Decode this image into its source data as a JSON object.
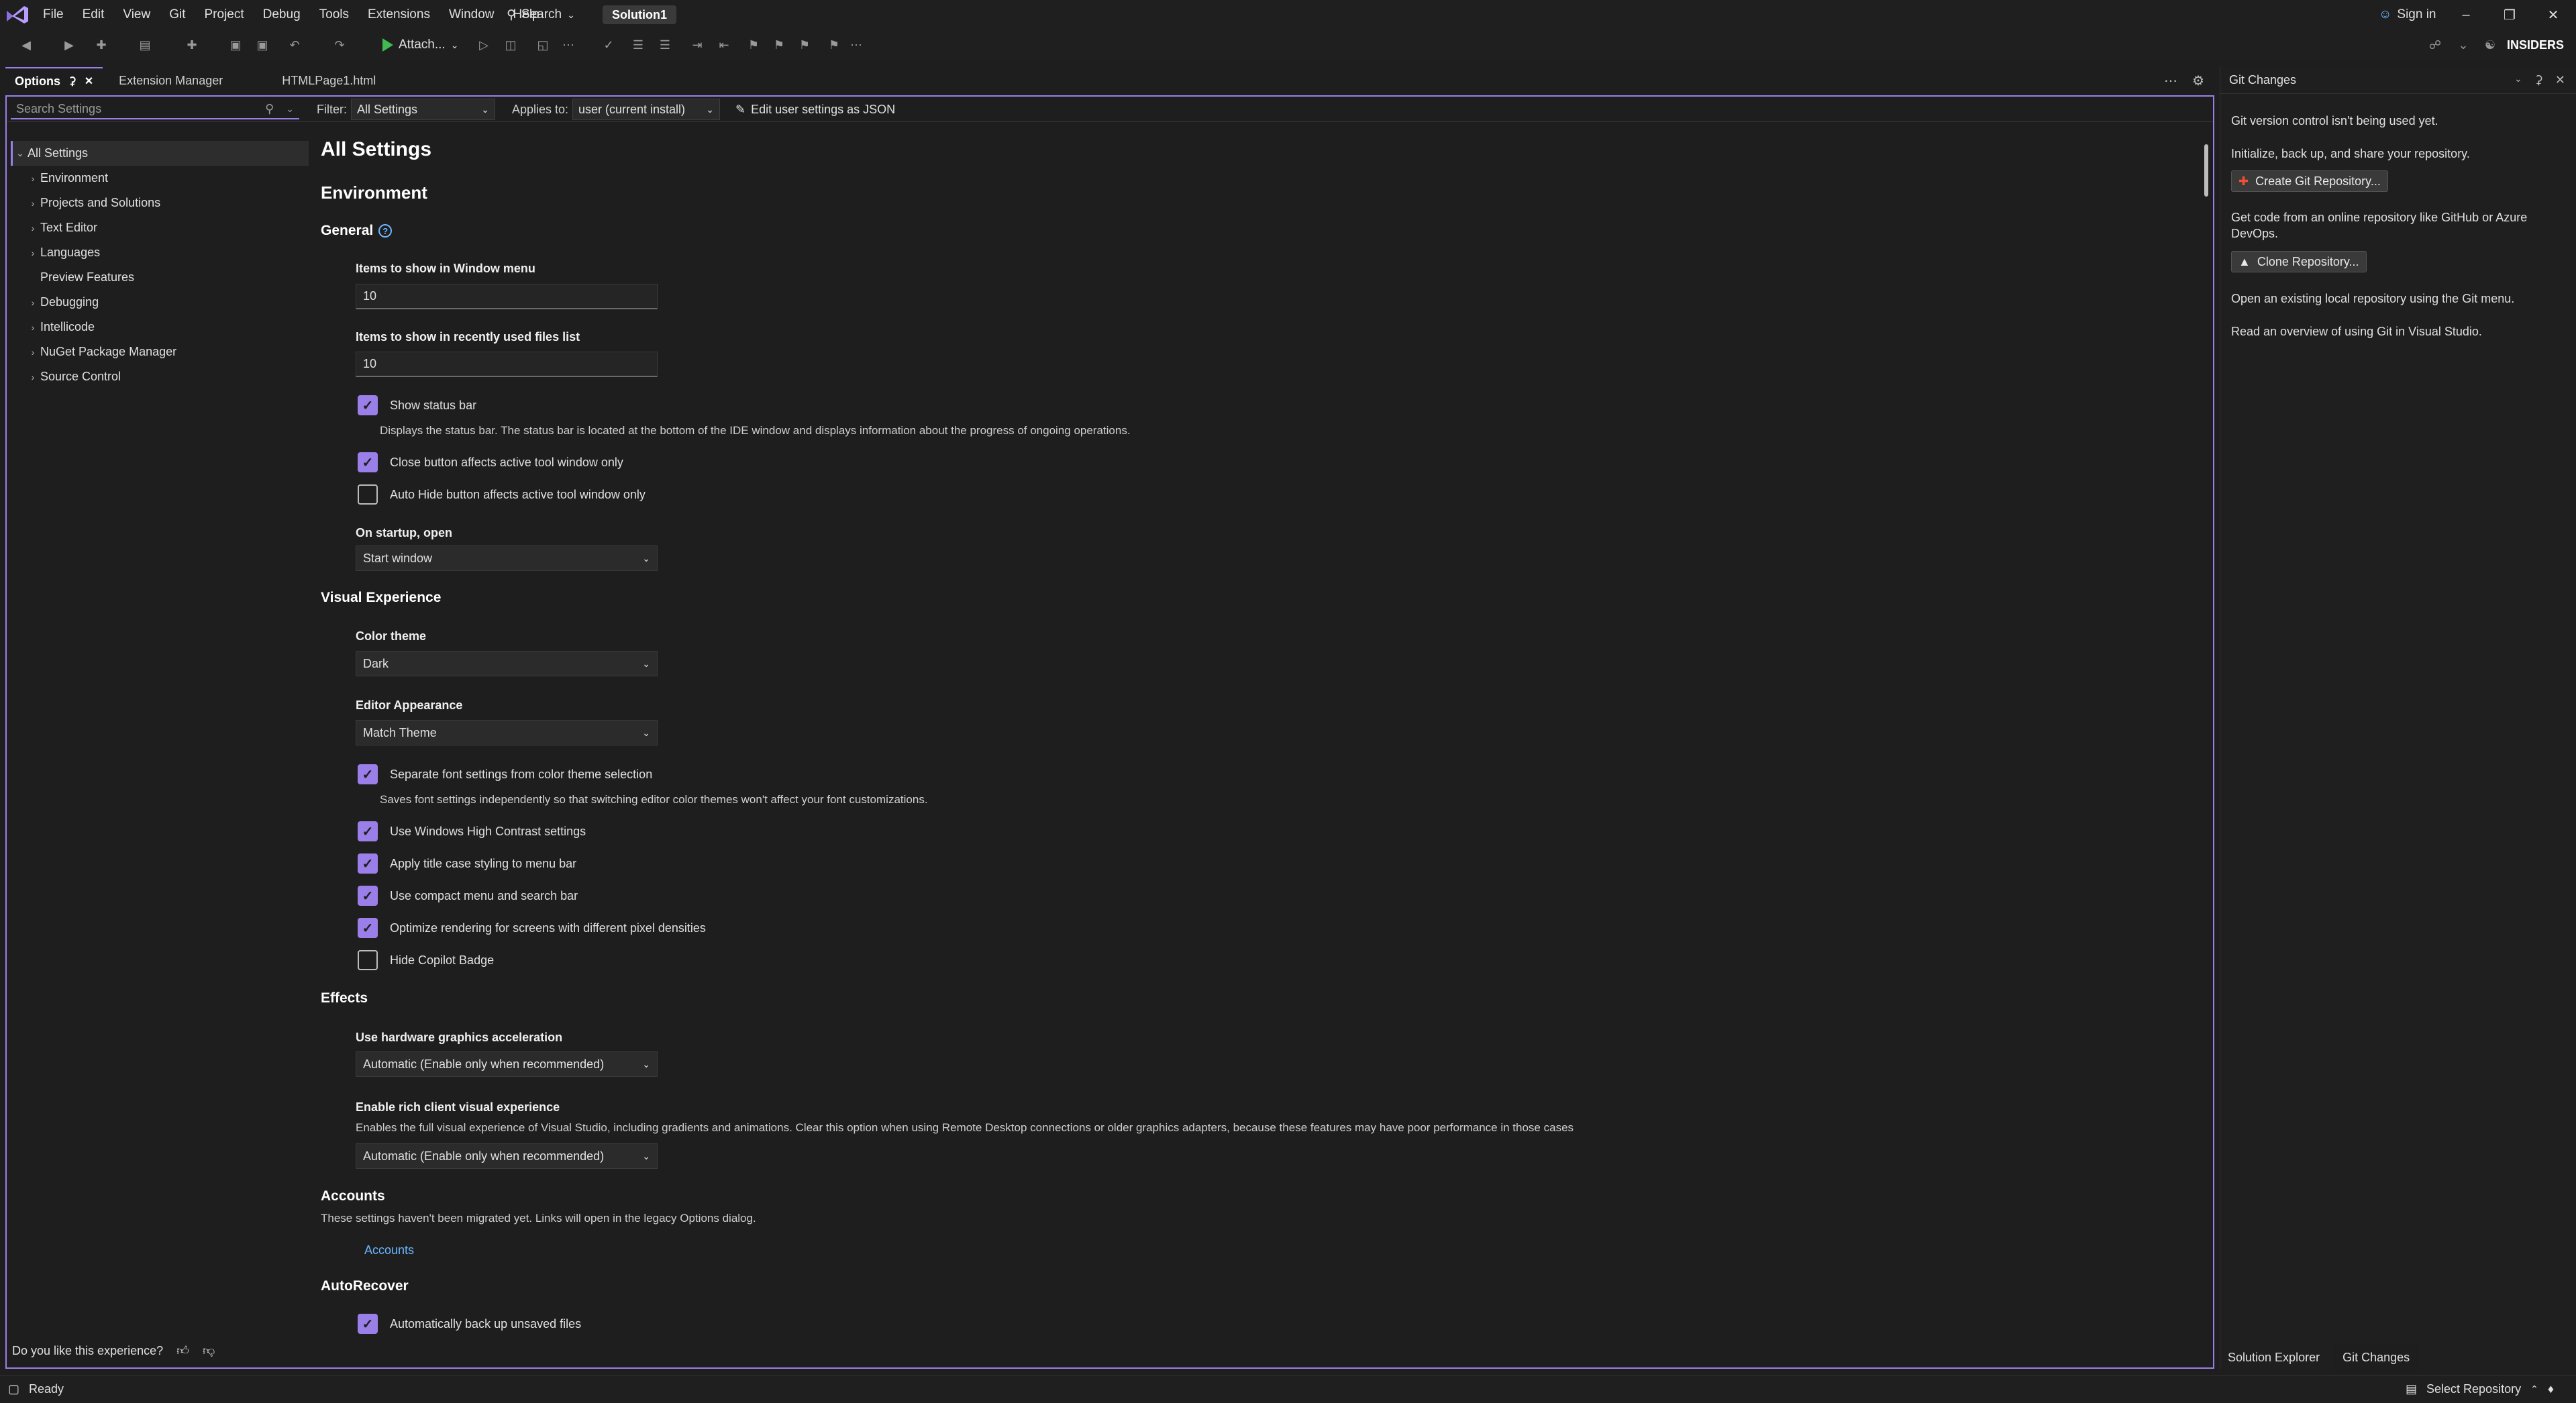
{
  "menu": {
    "items": [
      "File",
      "Edit",
      "View",
      "Git",
      "Project",
      "Debug",
      "Tools",
      "Extensions",
      "Window",
      "Help"
    ],
    "search_label": "Search",
    "solution": "Solution1",
    "sign_in": "Sign in"
  },
  "toolbar": {
    "attach_label": "Attach...",
    "insiders_label": "INSIDERS"
  },
  "tabs": [
    {
      "label": "Options",
      "active": true
    },
    {
      "label": "Extension Manager",
      "active": false
    },
    {
      "label": "HTMLPage1.html",
      "active": false
    }
  ],
  "filterbar": {
    "search_placeholder": "Search Settings",
    "filter_label": "Filter:",
    "filter_value": "All Settings",
    "applies_label": "Applies to:",
    "applies_value": "user (current install)",
    "edit_json_label": "Edit user settings as JSON"
  },
  "tree": {
    "items": [
      {
        "label": "All Settings",
        "expandable": true,
        "expanded": true,
        "level": 0
      },
      {
        "label": "Environment",
        "expandable": true,
        "level": 1
      },
      {
        "label": "Projects and Solutions",
        "expandable": true,
        "level": 1
      },
      {
        "label": "Text Editor",
        "expandable": true,
        "level": 1
      },
      {
        "label": "Languages",
        "expandable": true,
        "level": 1
      },
      {
        "label": "Preview Features",
        "expandable": false,
        "level": 1
      },
      {
        "label": "Debugging",
        "expandable": true,
        "level": 1
      },
      {
        "label": "Intellicode",
        "expandable": true,
        "level": 1
      },
      {
        "label": "NuGet Package Manager",
        "expandable": true,
        "level": 1
      },
      {
        "label": "Source Control",
        "expandable": true,
        "level": 1
      }
    ]
  },
  "content": {
    "title": "All Settings",
    "environment_heading": "Environment",
    "general_heading": "General",
    "window_menu_label": "Items to show in Window menu",
    "window_menu_value": "10",
    "recent_files_label": "Items to show in recently used files list",
    "recent_files_value": "10",
    "show_status_bar": {
      "label": "Show status bar",
      "checked": true,
      "desc": "Displays the status bar. The status bar is located at the bottom of the IDE window and displays information about the progress of ongoing operations."
    },
    "close_button": {
      "label": "Close button affects active tool window only",
      "checked": true
    },
    "auto_hide": {
      "label": "Auto Hide button affects active tool window only",
      "checked": false
    },
    "startup_label": "On startup, open",
    "startup_value": "Start window",
    "visual_heading": "Visual Experience",
    "color_theme_label": "Color theme",
    "color_theme_value": "Dark",
    "editor_appearance_label": "Editor Appearance",
    "editor_appearance_value": "Match Theme",
    "separate_font": {
      "label": "Separate font settings from color theme selection",
      "checked": true,
      "desc": "Saves font settings independently so that switching editor color themes won't affect your font customizations."
    },
    "high_contrast": {
      "label": "Use Windows High Contrast settings",
      "checked": true
    },
    "title_case": {
      "label": "Apply title case styling to menu bar",
      "checked": true
    },
    "compact_menu": {
      "label": "Use compact menu and search bar",
      "checked": true
    },
    "optimize_rendering": {
      "label": "Optimize rendering for screens with different pixel densities",
      "checked": true
    },
    "hide_copilot": {
      "label": "Hide Copilot Badge",
      "checked": false
    },
    "effects_heading": "Effects",
    "hw_accel_label": "Use hardware graphics acceleration",
    "hw_accel_value": "Automatic (Enable only when recommended)",
    "rich_client_label": "Enable rich client visual experience",
    "rich_client_desc": "Enables the full visual experience of Visual Studio, including gradients and animations. Clear this option when using Remote Desktop connections or older graphics adapters, because these features may have poor performance in those cases",
    "rich_client_value": "Automatic (Enable only when recommended)",
    "accounts_heading": "Accounts",
    "accounts_desc": "These settings haven't been migrated yet. Links will open in the legacy Options dialog.",
    "accounts_link": "Accounts",
    "autorecover_heading": "AutoRecover",
    "auto_backup": {
      "label": "Automatically back up unsaved files",
      "checked": true
    }
  },
  "feedback": {
    "question": "Do you like this experience?"
  },
  "git": {
    "title": "Git Changes",
    "not_used": "Git version control isn't being used yet.",
    "init_text": "Initialize, back up, and share your repository.",
    "create_button": "Create Git Repository...",
    "online_text": "Get code from an online repository like GitHub or Azure DevOps.",
    "clone_button": "Clone Repository...",
    "open_text": "Open an existing local repository using the Git menu.",
    "overview_link": "Read an overview of using Git in Visual Studio.",
    "panel_tabs": [
      "Solution Explorer",
      "Git Changes"
    ]
  },
  "status": {
    "ready": "Ready",
    "select_repo": "Select Repository"
  },
  "colors": {
    "accent": "#9b7fe8",
    "link": "#6cb6ff",
    "play": "#3fb950"
  }
}
